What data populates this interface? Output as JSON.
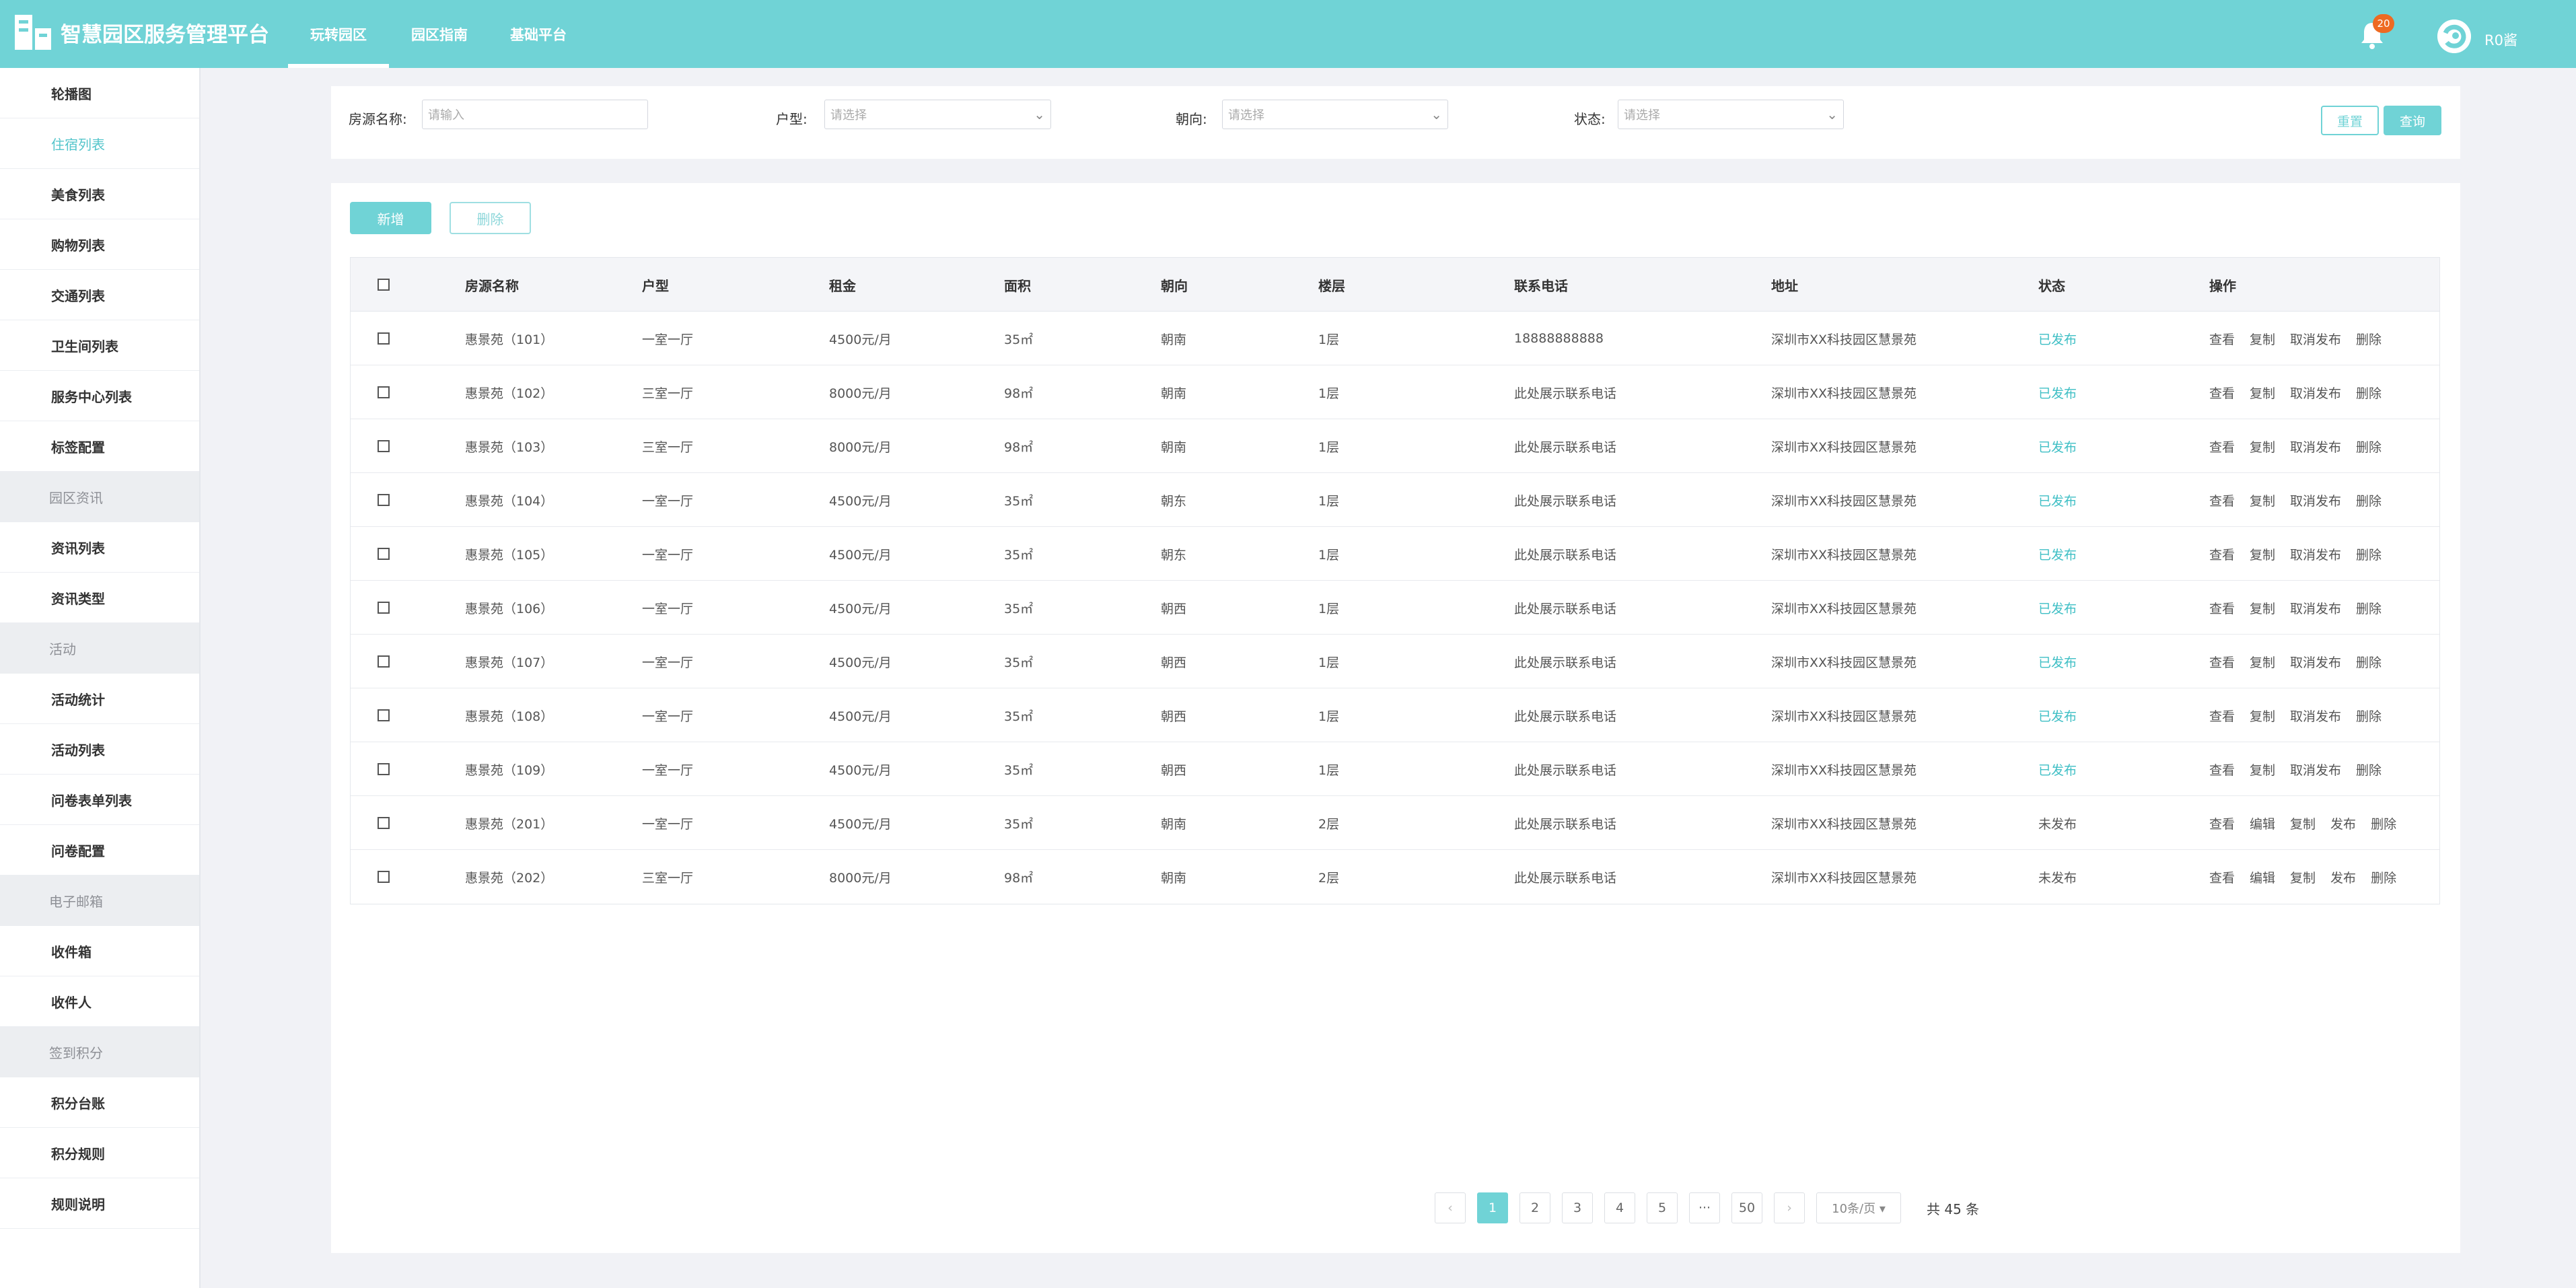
{
  "app": {
    "title": "智慧园区服务管理平台"
  },
  "top_nav": {
    "tabs": [
      "玩转园区",
      "园区指南",
      "基础平台"
    ],
    "active_index": 0
  },
  "header": {
    "notification_count": "20",
    "username": "R0酱"
  },
  "sidebar": {
    "items": [
      {
        "label": "轮播图",
        "type": "item"
      },
      {
        "label": "住宿列表",
        "type": "item",
        "active": true
      },
      {
        "label": "美食列表",
        "type": "item"
      },
      {
        "label": "购物列表",
        "type": "item"
      },
      {
        "label": "交通列表",
        "type": "item"
      },
      {
        "label": "卫生间列表",
        "type": "item"
      },
      {
        "label": "服务中心列表",
        "type": "item"
      },
      {
        "label": "标签配置",
        "type": "item"
      },
      {
        "label": "园区资讯",
        "type": "group"
      },
      {
        "label": "资讯列表",
        "type": "item"
      },
      {
        "label": "资讯类型",
        "type": "item"
      },
      {
        "label": "活动",
        "type": "group"
      },
      {
        "label": "活动统计",
        "type": "item"
      },
      {
        "label": "活动列表",
        "type": "item"
      },
      {
        "label": "问卷表单列表",
        "type": "item"
      },
      {
        "label": "问卷配置",
        "type": "item"
      },
      {
        "label": "电子邮箱",
        "type": "group"
      },
      {
        "label": "收件箱",
        "type": "item"
      },
      {
        "label": "收件人",
        "type": "item"
      },
      {
        "label": "签到积分",
        "type": "group"
      },
      {
        "label": "积分台账",
        "type": "item"
      },
      {
        "label": "积分规则",
        "type": "item"
      },
      {
        "label": "规则说明",
        "type": "item"
      }
    ]
  },
  "filters": {
    "name_label": "房源名称:",
    "name_placeholder": "请输入",
    "type_label": "户型:",
    "type_placeholder": "请选择",
    "orientation_label": "朝向:",
    "orientation_placeholder": "请选择",
    "status_label": "状态:",
    "status_placeholder": "请选择",
    "reset_label": "重置",
    "query_label": "查询"
  },
  "toolbar": {
    "add_label": "新增",
    "delete_label": "删除"
  },
  "table": {
    "headers": [
      "房源名称",
      "户型",
      "租金",
      "面积",
      "朝向",
      "楼层",
      "联系电话",
      "地址",
      "状态",
      "操作"
    ],
    "rows": [
      {
        "name": "惠景苑（101）",
        "layout": "一室一厅",
        "rent": "4500元/月",
        "area": "35㎡",
        "orientation": "朝南",
        "floor": "1层",
        "phone": "18888888888",
        "address": "深圳市XX科技园区慧景苑",
        "status": "已发布",
        "published": true,
        "actions": [
          "查看",
          "复制",
          "取消发布",
          "删除"
        ]
      },
      {
        "name": "惠景苑（102）",
        "layout": "三室一厅",
        "rent": "8000元/月",
        "area": "98㎡",
        "orientation": "朝南",
        "floor": "1层",
        "phone": "此处展示联系电话",
        "address": "深圳市XX科技园区慧景苑",
        "status": "已发布",
        "published": true,
        "actions": [
          "查看",
          "复制",
          "取消发布",
          "删除"
        ]
      },
      {
        "name": "惠景苑（103）",
        "layout": "三室一厅",
        "rent": "8000元/月",
        "area": "98㎡",
        "orientation": "朝南",
        "floor": "1层",
        "phone": "此处展示联系电话",
        "address": "深圳市XX科技园区慧景苑",
        "status": "已发布",
        "published": true,
        "actions": [
          "查看",
          "复制",
          "取消发布",
          "删除"
        ]
      },
      {
        "name": "惠景苑（104）",
        "layout": "一室一厅",
        "rent": "4500元/月",
        "area": "35㎡",
        "orientation": "朝东",
        "floor": "1层",
        "phone": "此处展示联系电话",
        "address": "深圳市XX科技园区慧景苑",
        "status": "已发布",
        "published": true,
        "actions": [
          "查看",
          "复制",
          "取消发布",
          "删除"
        ]
      },
      {
        "name": "惠景苑（105）",
        "layout": "一室一厅",
        "rent": "4500元/月",
        "area": "35㎡",
        "orientation": "朝东",
        "floor": "1层",
        "phone": "此处展示联系电话",
        "address": "深圳市XX科技园区慧景苑",
        "status": "已发布",
        "published": true,
        "actions": [
          "查看",
          "复制",
          "取消发布",
          "删除"
        ]
      },
      {
        "name": "惠景苑（106）",
        "layout": "一室一厅",
        "rent": "4500元/月",
        "area": "35㎡",
        "orientation": "朝西",
        "floor": "1层",
        "phone": "此处展示联系电话",
        "address": "深圳市XX科技园区慧景苑",
        "status": "已发布",
        "published": true,
        "actions": [
          "查看",
          "复制",
          "取消发布",
          "删除"
        ]
      },
      {
        "name": "惠景苑（107）",
        "layout": "一室一厅",
        "rent": "4500元/月",
        "area": "35㎡",
        "orientation": "朝西",
        "floor": "1层",
        "phone": "此处展示联系电话",
        "address": "深圳市XX科技园区慧景苑",
        "status": "已发布",
        "published": true,
        "actions": [
          "查看",
          "复制",
          "取消发布",
          "删除"
        ]
      },
      {
        "name": "惠景苑（108）",
        "layout": "一室一厅",
        "rent": "4500元/月",
        "area": "35㎡",
        "orientation": "朝西",
        "floor": "1层",
        "phone": "此处展示联系电话",
        "address": "深圳市XX科技园区慧景苑",
        "status": "已发布",
        "published": true,
        "actions": [
          "查看",
          "复制",
          "取消发布",
          "删除"
        ]
      },
      {
        "name": "惠景苑（109）",
        "layout": "一室一厅",
        "rent": "4500元/月",
        "area": "35㎡",
        "orientation": "朝西",
        "floor": "1层",
        "phone": "此处展示联系电话",
        "address": "深圳市XX科技园区慧景苑",
        "status": "已发布",
        "published": true,
        "actions": [
          "查看",
          "复制",
          "取消发布",
          "删除"
        ]
      },
      {
        "name": "惠景苑（201）",
        "layout": "一室一厅",
        "rent": "4500元/月",
        "area": "35㎡",
        "orientation": "朝南",
        "floor": "2层",
        "phone": "此处展示联系电话",
        "address": "深圳市XX科技园区慧景苑",
        "status": "未发布",
        "published": false,
        "actions": [
          "查看",
          "编辑",
          "复制",
          "发布",
          "删除"
        ]
      },
      {
        "name": "惠景苑（202）",
        "layout": "三室一厅",
        "rent": "8000元/月",
        "area": "98㎡",
        "orientation": "朝南",
        "floor": "2层",
        "phone": "此处展示联系电话",
        "address": "深圳市XX科技园区慧景苑",
        "status": "未发布",
        "published": false,
        "actions": [
          "查看",
          "编辑",
          "复制",
          "发布",
          "删除"
        ]
      }
    ]
  },
  "pagination": {
    "prev": "‹",
    "next": "›",
    "pages": [
      "1",
      "2",
      "3",
      "4",
      "5"
    ],
    "ellipsis": "···",
    "last_page": "50",
    "current": "1",
    "page_size": "10条/页 ▾",
    "total": "共 45 条"
  },
  "colors": {
    "accent": "#70d3d6",
    "published": "#3fbfc5",
    "badge": "#ee6a22"
  }
}
